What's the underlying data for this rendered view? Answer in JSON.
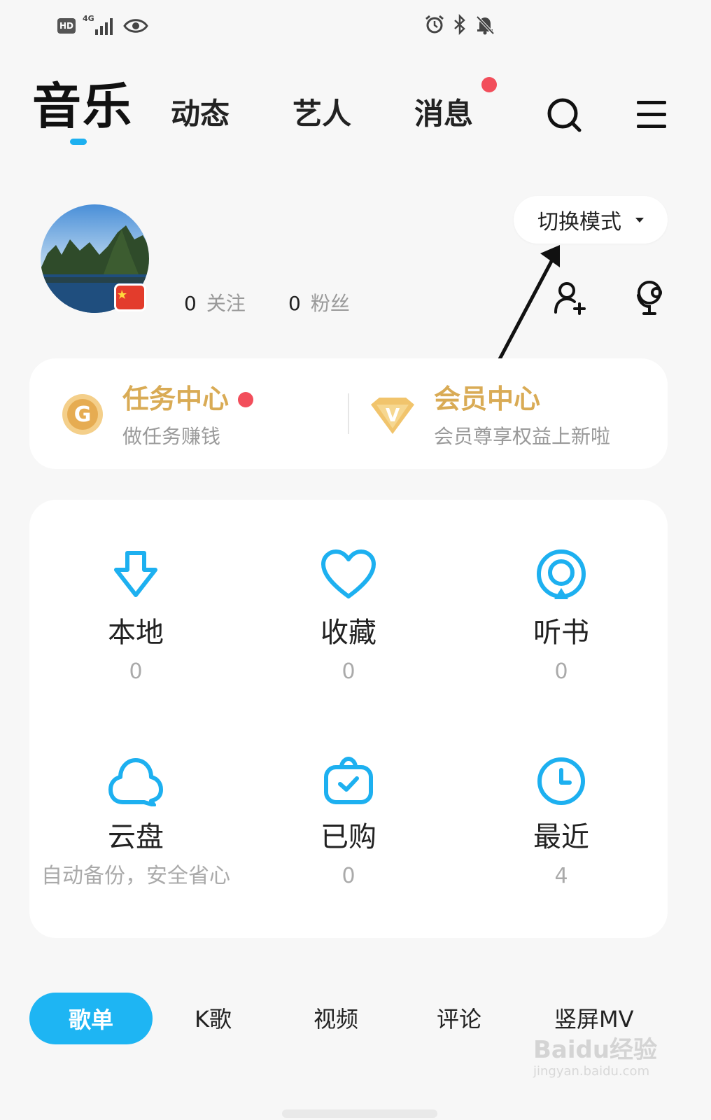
{
  "status_bar": {
    "hd_label": "HD",
    "network_label": "4G",
    "icons_left": [
      "hd-icon",
      "signal-4g-icon",
      "eye-icon"
    ],
    "icons_right": [
      "alarm-icon",
      "bluetooth-icon",
      "mute-bell-icon"
    ]
  },
  "nav": {
    "tabs": [
      {
        "label": "音乐",
        "active": true
      },
      {
        "label": "动态"
      },
      {
        "label": "艺人"
      },
      {
        "label": "消息",
        "badge": true
      }
    ],
    "search_icon": "search-icon",
    "menu_icon": "menu-icon"
  },
  "profile": {
    "follow_count": "0",
    "follow_label": "关注",
    "fans_count": "0",
    "fans_label": "粉丝",
    "switch_mode_label": "切换模式",
    "add_friend_icon": "add-user-icon",
    "voice_icon": "mic-icon"
  },
  "promo": {
    "task_title": "任务中心",
    "task_sub": "做任务赚钱",
    "task_icon_letter": "G",
    "vip_title": "会员中心",
    "vip_sub": "会员尊享权益上新啦",
    "vip_icon_letter": "V",
    "gold_color": "#d9ab55"
  },
  "grid": [
    {
      "label": "本地",
      "count": "0",
      "icon": "download-icon"
    },
    {
      "label": "收藏",
      "count": "0",
      "icon": "heart-icon"
    },
    {
      "label": "听书",
      "count": "0",
      "icon": "audiobook-icon"
    },
    {
      "label": "云盘",
      "sub": "自动备份，安全省心",
      "icon": "cloud-icon"
    },
    {
      "label": "已购",
      "count": "0",
      "icon": "purchased-bag-icon"
    },
    {
      "label": "最近",
      "count": "4",
      "icon": "clock-icon"
    }
  ],
  "bottom_tabs": [
    {
      "label": "歌单",
      "active": true
    },
    {
      "label": "K歌"
    },
    {
      "label": "视频"
    },
    {
      "label": "评论"
    },
    {
      "label": "竖屏MV"
    }
  ],
  "watermark": {
    "brand": "Baidu经验",
    "url": "jingyan.baidu.com"
  },
  "colors": {
    "accent": "#1eb5f3",
    "badge": "#f24e5b",
    "gold": "#d9ab55"
  }
}
